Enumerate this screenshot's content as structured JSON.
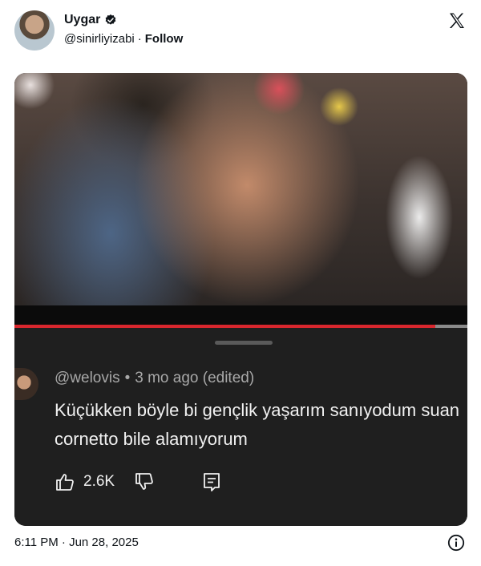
{
  "author": {
    "name": "Uygar",
    "handle": "@sinirliyizabi",
    "separator": "·",
    "follow_label": "Follow",
    "verified_icon": "verified-badge-icon"
  },
  "platform_icon": "x-logo-icon",
  "media": {
    "video_progress": 0.93,
    "colors": {
      "progress": "#d9272e",
      "panel": "#1f1f1f"
    },
    "comment": {
      "username": "@welovis",
      "separator": "•",
      "meta": "3 mo ago (edited)",
      "text": "Küçükken böyle bi gençlik yaşarım sanıyodum suan cornetto bile alamıyorum",
      "likes": "2.6K"
    }
  },
  "footer": {
    "timestamp": "6:11 PM · Jun 28, 2025",
    "info_icon": "info-icon"
  }
}
